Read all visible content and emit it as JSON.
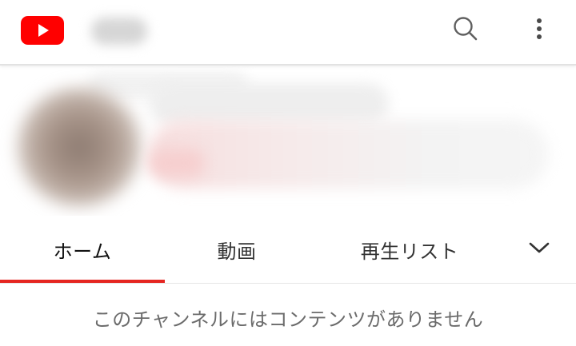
{
  "header": {
    "logo_icon": "youtube-logo-icon",
    "search_icon": "search-icon",
    "more_icon": "more-vert-icon",
    "brand_color": "#ff0000"
  },
  "channel": {
    "avatar": "blurred-avatar"
  },
  "tabs": [
    {
      "label": "ホーム",
      "active": true
    },
    {
      "label": "動画",
      "active": false
    },
    {
      "label": "再生リスト",
      "active": false
    }
  ],
  "tab_more_icon": "chevron-down-icon",
  "empty_message": "このチャンネルにはコンテンツがありません",
  "colors": {
    "active_tab_indicator": "#e52621",
    "empty_text": "#6b6b6b"
  }
}
